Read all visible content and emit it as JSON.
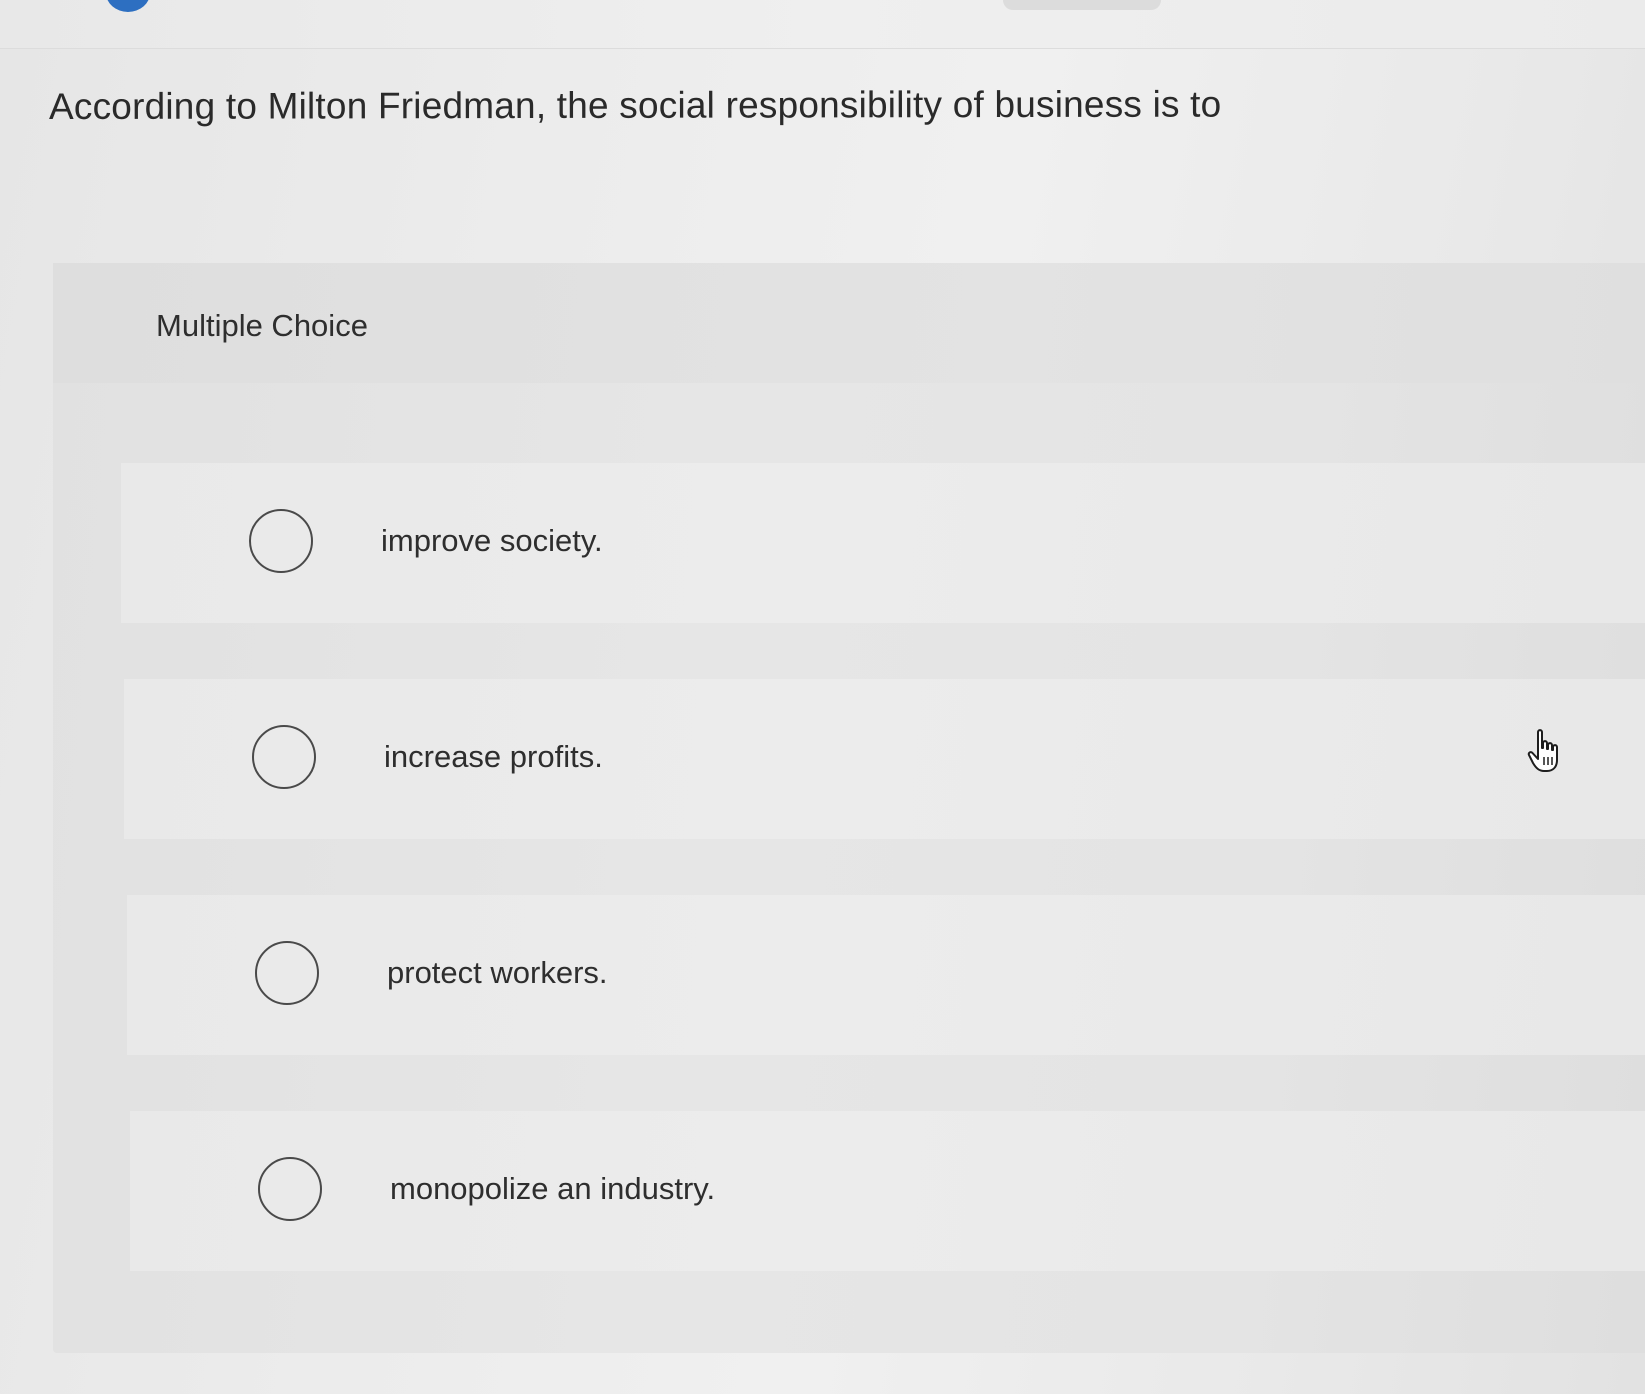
{
  "question": {
    "text": "According to Milton Friedman, the social responsibility of business is to"
  },
  "answer_panel": {
    "label": "Multiple Choice",
    "options": [
      {
        "label": "improve society.",
        "selected": false
      },
      {
        "label": "increase profits.",
        "selected": false
      },
      {
        "label": "protect workers.",
        "selected": false
      },
      {
        "label": "monopolize an industry.",
        "selected": false
      }
    ]
  },
  "icons": {
    "pointer": "hand-pointer-icon",
    "radio": "radio-unchecked-icon"
  },
  "colors": {
    "radio_border": "#4a4a4a",
    "text": "#2e2e2e",
    "top_badge": "#2d6fc1"
  }
}
